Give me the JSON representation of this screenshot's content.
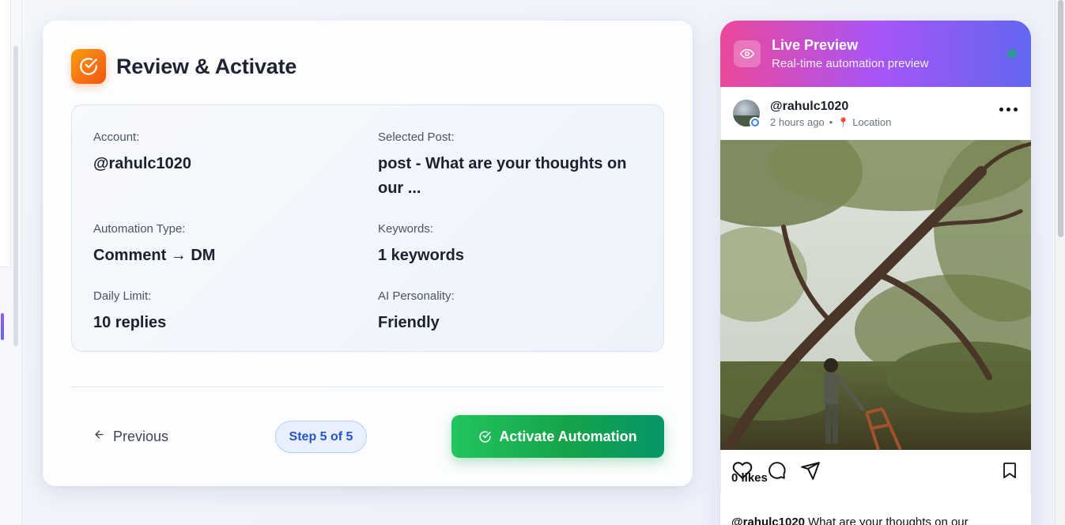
{
  "review": {
    "title": "Review & Activate",
    "fields": [
      {
        "label": "Account:",
        "value": "@rahulc1020"
      },
      {
        "label": "Selected Post:",
        "value": "post - What are your thoughts on our ..."
      },
      {
        "label": "Automation Type:",
        "value": "Comment → DM"
      },
      {
        "label": "Keywords:",
        "value": "1 keywords"
      },
      {
        "label": "Daily Limit:",
        "value": "10 replies"
      },
      {
        "label": "AI Personality:",
        "value": "Friendly"
      }
    ],
    "previous_label": "Previous",
    "step_label": "Step 5 of 5",
    "activate_label": "Activate Automation"
  },
  "preview": {
    "title": "Live Preview",
    "subtitle": "Real-time automation preview",
    "post": {
      "username": "@rahulc1020",
      "time": "2 hours ago",
      "location": "Location",
      "likes": "0 likes",
      "caption_user": "@rahulc1020",
      "caption_text": "What are your thoughts on our"
    }
  },
  "colors": {
    "accent_green": "#16a34a",
    "header_gradient": [
      "#ec4899",
      "#a855f7",
      "#6366f1"
    ],
    "step_blue": "#2554c7",
    "icon_orange": "#f97316"
  },
  "icons": {
    "header": "check-circle-icon",
    "preview": "eye-icon",
    "previous": "arrow-left-icon",
    "activate": "check-circle-icon",
    "actions": [
      "heart-icon",
      "comment-icon",
      "send-icon",
      "bookmark-icon"
    ]
  }
}
